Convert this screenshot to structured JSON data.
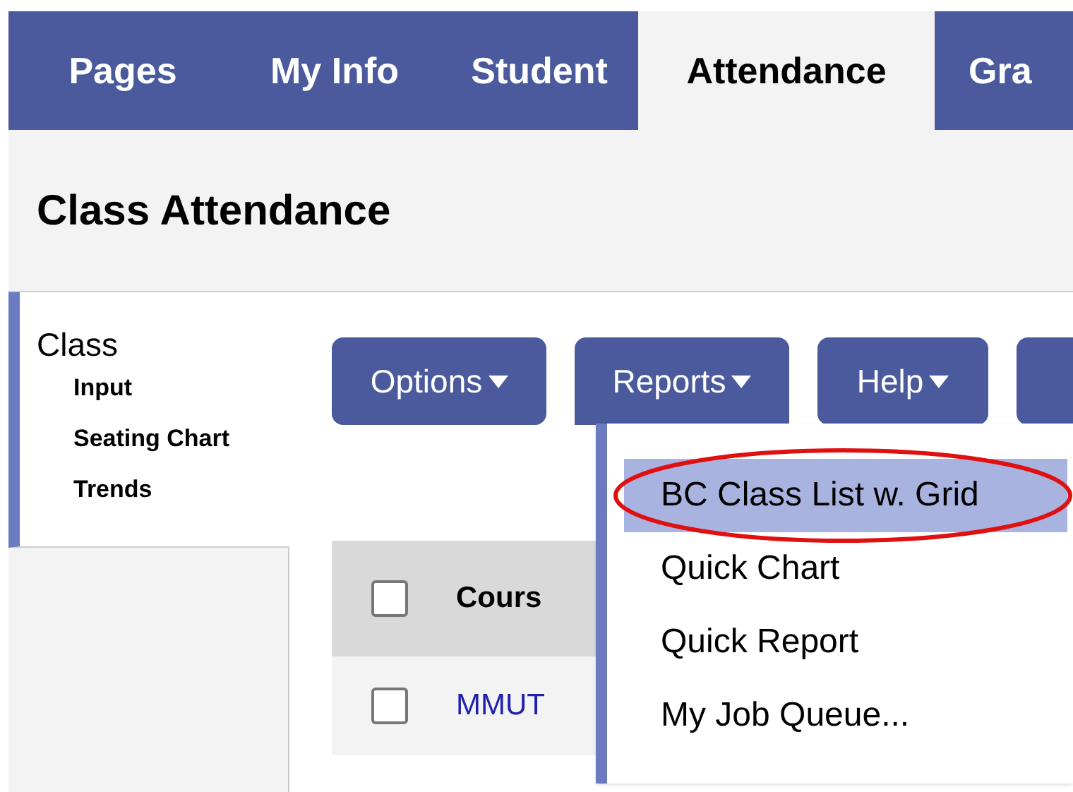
{
  "tabs": [
    {
      "label": "Pages",
      "selected": false
    },
    {
      "label": "My Info",
      "selected": false
    },
    {
      "label": "Student",
      "selected": false
    },
    {
      "label": "Attendance",
      "selected": true
    },
    {
      "label": "Gra",
      "selected": false
    }
  ],
  "page_title": "Class Attendance",
  "sidebar": {
    "heading": "Class",
    "items": [
      "Input",
      "Seating Chart",
      "Trends"
    ]
  },
  "toolbar": [
    {
      "label": "Options",
      "open": false
    },
    {
      "label": "Reports",
      "open": true
    },
    {
      "label": "Help",
      "open": false
    }
  ],
  "table": {
    "header": {
      "checked": false,
      "column_1": "Cours"
    },
    "rows": [
      {
        "checked": false,
        "column_1": "MMUT"
      }
    ]
  },
  "reports_menu": [
    {
      "label": "BC Class List w. Grid",
      "selected": true,
      "annotated": true
    },
    {
      "label": "Quick Chart",
      "selected": false,
      "annotated": false
    },
    {
      "label": "Quick Report",
      "selected": false,
      "annotated": false
    },
    {
      "label": "My Job Queue...",
      "selected": false,
      "annotated": false
    }
  ]
}
